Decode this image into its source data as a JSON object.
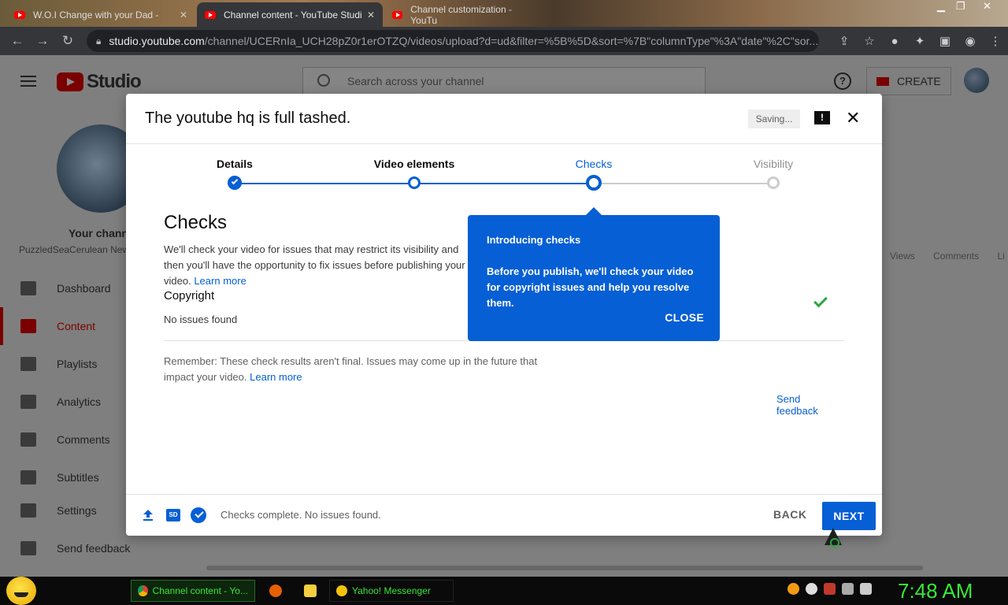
{
  "browser": {
    "tabs": [
      {
        "label": "W.O.I Change with your Dad -",
        "active": false
      },
      {
        "label": "Channel content - YouTube Studi",
        "active": true
      },
      {
        "label": "Channel customization - YouTu",
        "active": false
      }
    ],
    "url_host": "studio.youtube.com",
    "url_path": "/channel/UCERnIa_UCH28pZ0r1erOTZQ/videos/upload?d=ud&filter=%5B%5D&sort=%7B\"columnType\"%3A\"date\"%2C\"sor..."
  },
  "studio": {
    "logo_text": "Studio",
    "search_placeholder": "Search across your channel",
    "create_label": "CREATE",
    "help_glyph": "?",
    "channel_label": "Your channel",
    "channel_name": "PuzzledSeaCerulean Newt",
    "nav": [
      {
        "label": "Dashboard",
        "icon": "dashboard-icon",
        "active": false
      },
      {
        "label": "Content",
        "icon": "content-icon",
        "active": true
      },
      {
        "label": "Playlists",
        "icon": "playlists-icon",
        "active": false
      },
      {
        "label": "Analytics",
        "icon": "analytics-icon",
        "active": false
      },
      {
        "label": "Comments",
        "icon": "comments-icon",
        "active": false
      },
      {
        "label": "Subtitles",
        "icon": "subtitles-icon",
        "active": false
      },
      {
        "label": "Settings",
        "icon": "settings-icon",
        "active": false
      },
      {
        "label": "Send feedback",
        "icon": "feedback-icon",
        "active": false
      }
    ],
    "bg_columns": "Views Comments Li"
  },
  "modal": {
    "title": "The youtube hq is full tashed.",
    "saving_label": "Saving...",
    "feedback_glyph": "!",
    "close_glyph": "✕",
    "steps": [
      {
        "label": "Details",
        "state": "done"
      },
      {
        "label": "Video elements",
        "state": "done"
      },
      {
        "label": "Checks",
        "state": "current"
      },
      {
        "label": "Visibility",
        "state": "future"
      }
    ],
    "heading": "Checks",
    "description": "We'll check your video for issues that may restrict its visibility and then you'll have the opportunity to fix issues before publishing your video.",
    "learn_more": "Learn more",
    "copyright_heading": "Copyright",
    "copyright_status": "No issues found",
    "remember": "Remember: These check results aren't final. Issues may come up in the future that impact your video.",
    "remember_learn_more": "Learn more",
    "send_feedback": "Send feedback",
    "sd_badge": "SD",
    "footer_status": "Checks complete. No issues found.",
    "back_label": "BACK",
    "next_label": "NEXT",
    "accent": "#065fd4",
    "success": "#2ba640"
  },
  "popover": {
    "title": "Introducing checks",
    "body": "Before you publish, we'll check your video for copyright issues and help you resolve them.",
    "close_label": "CLOSE"
  },
  "taskbar": {
    "items": [
      {
        "label": "Channel content - Yo...",
        "active": true
      },
      {
        "label": "Yahoo! Messenger",
        "active": false
      }
    ],
    "clock": "7:48 AM"
  }
}
